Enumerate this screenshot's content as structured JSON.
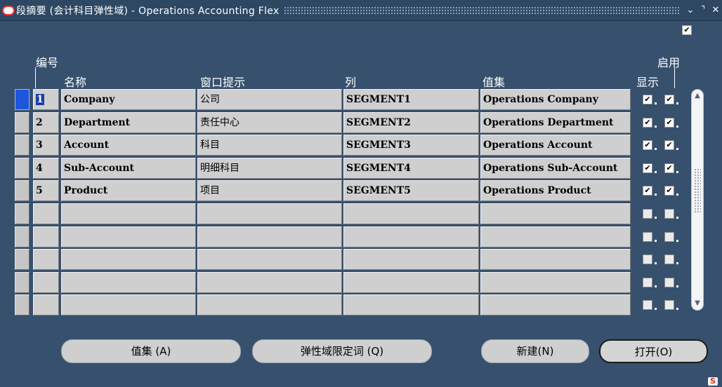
{
  "window": {
    "title": "段摘要 (会计科目弹性域) - Operations Accounting Flex",
    "minimize_glyph": "⌄",
    "maximize_glyph": "⌝",
    "close_glyph": "✕"
  },
  "top_check": "✔",
  "headers": {
    "number": "编号",
    "name": "名称",
    "window_prompt": "窗口提示",
    "column": "列",
    "value_set": "值集",
    "enabled": "启用",
    "displayed": "显示"
  },
  "rows": [
    {
      "num": "1",
      "name": "Company",
      "prompt": "公司",
      "column": "SEGMENT1",
      "value_set": "Operations Company",
      "displayed": true,
      "enabled": true
    },
    {
      "num": "2",
      "name": "Department",
      "prompt": "责任中心",
      "column": "SEGMENT2",
      "value_set": "Operations Department",
      "displayed": true,
      "enabled": true
    },
    {
      "num": "3",
      "name": "Account",
      "prompt": "科目",
      "column": "SEGMENT3",
      "value_set": "Operations Account",
      "displayed": true,
      "enabled": true
    },
    {
      "num": "4",
      "name": "Sub-Account",
      "prompt": "明细科目",
      "column": "SEGMENT4",
      "value_set": "Operations Sub-Account",
      "displayed": true,
      "enabled": true
    },
    {
      "num": "5",
      "name": "Product",
      "prompt": "项目",
      "column": "SEGMENT5",
      "value_set": "Operations Product",
      "displayed": true,
      "enabled": true
    },
    {
      "num": "",
      "name": "",
      "prompt": "",
      "column": "",
      "value_set": "",
      "displayed": false,
      "enabled": false
    },
    {
      "num": "",
      "name": "",
      "prompt": "",
      "column": "",
      "value_set": "",
      "displayed": false,
      "enabled": false
    },
    {
      "num": "",
      "name": "",
      "prompt": "",
      "column": "",
      "value_set": "",
      "displayed": false,
      "enabled": false
    },
    {
      "num": "",
      "name": "",
      "prompt": "",
      "column": "",
      "value_set": "",
      "displayed": false,
      "enabled": false
    },
    {
      "num": "",
      "name": "",
      "prompt": "",
      "column": "",
      "value_set": "",
      "displayed": false,
      "enabled": false
    }
  ],
  "check_glyph": "✔",
  "buttons": {
    "value_set": "值集 (A)",
    "qualifiers": "弹性域限定词 (Q)",
    "new": "新建(N)",
    "open": "打开(O)"
  },
  "colors": {
    "background": "#36506d",
    "selected_row": "#1c57d9"
  }
}
